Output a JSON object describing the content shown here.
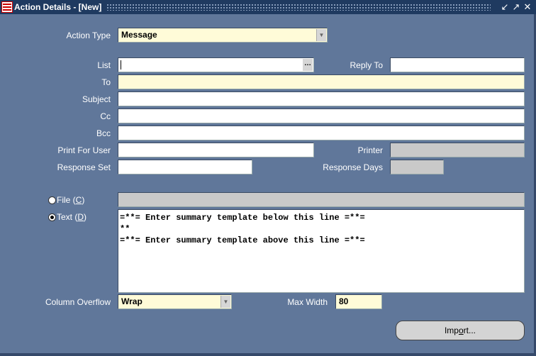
{
  "window": {
    "title": "Action Details - [New]",
    "buttons": [
      "minimize",
      "maximize",
      "close"
    ]
  },
  "form": {
    "action_type": {
      "label": "Action Type",
      "value": "Message"
    },
    "list": {
      "label": "List",
      "value": ""
    },
    "reply_to": {
      "label": "Reply To",
      "value": ""
    },
    "to": {
      "label": "To",
      "value": ""
    },
    "subject": {
      "label": "Subject",
      "value": ""
    },
    "cc": {
      "label": "Cc",
      "value": ""
    },
    "bcc": {
      "label": "Bcc",
      "value": ""
    },
    "print_for_user": {
      "label": "Print For User",
      "value": ""
    },
    "printer": {
      "label": "Printer",
      "value": ""
    },
    "response_set": {
      "label": "Response Set",
      "value": ""
    },
    "response_days": {
      "label": "Response Days",
      "value": ""
    },
    "source": {
      "file": {
        "label_prefix": "File (",
        "mnemonic": "C",
        "label_suffix": ")",
        "selected": false,
        "value": ""
      },
      "text": {
        "label_prefix": "Text (",
        "mnemonic": "D",
        "label_suffix": ")",
        "selected": true
      }
    },
    "template_lines": [
      "=**= Enter summary template below this line =**=",
      "**",
      "=**= Enter summary template above this line =**="
    ],
    "column_overflow": {
      "label": "Column Overflow",
      "value": "Wrap"
    },
    "max_width": {
      "label": "Max Width",
      "value": "80"
    },
    "import_button": {
      "label_prefix": "Imp",
      "mnemonic": "o",
      "label_suffix": "rt..."
    }
  },
  "icons": {
    "app": "oracle-forms-icon",
    "dropdown": "dropdown-arrow-icon",
    "lov": "ellipsis-icon"
  }
}
